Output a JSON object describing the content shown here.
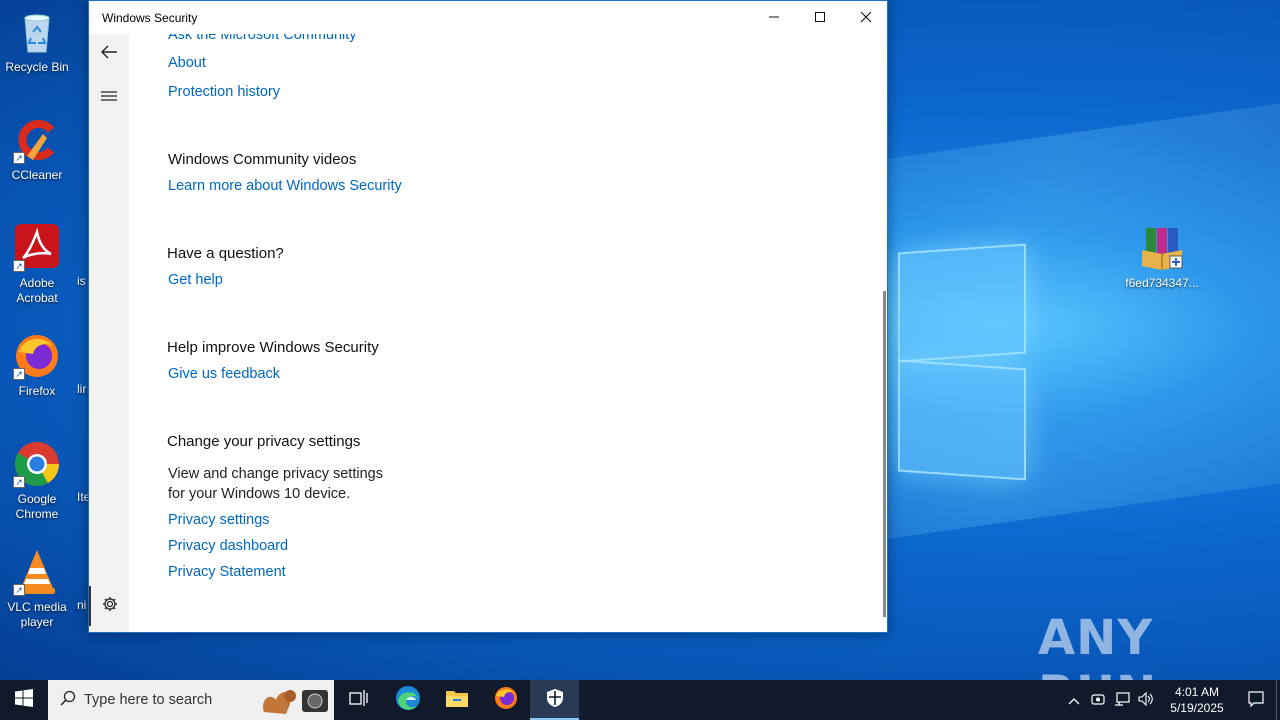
{
  "desktop": {
    "icons": [
      {
        "label": "Recycle Bin",
        "icon": "recycle-bin-icon"
      },
      {
        "label": "CCleaner",
        "icon": "ccleaner-icon"
      },
      {
        "label": "Adobe Acrobat",
        "icon": "adobe-acrobat-icon"
      },
      {
        "label": "Firefox",
        "icon": "firefox-icon"
      },
      {
        "label": "Google Chrome",
        "icon": "chrome-icon"
      },
      {
        "label": "VLC media player",
        "icon": "vlc-icon"
      },
      {
        "label": "f6ed734347...",
        "icon": "winrar-archive-icon"
      }
    ],
    "cut_labels": [
      "is",
      "lir",
      "Ite",
      "ni"
    ],
    "watermark": "ANY RUN"
  },
  "window": {
    "title": "Windows Security",
    "controls": {
      "minimize": "minimize-icon",
      "maximize": "maximize-icon",
      "close": "close-icon"
    },
    "nav": {
      "back": "back-arrow-icon",
      "menu": "hamburger-menu-icon",
      "settings": "gear-icon"
    },
    "content": {
      "ask_community": "Ask the Microsoft Community",
      "about": "About",
      "protection_history": "Protection history",
      "community_videos": {
        "heading": "Windows Community videos",
        "link": "Learn more about Windows Security"
      },
      "question": {
        "heading": "Have a question?",
        "link": "Get help"
      },
      "improve": {
        "heading": "Help improve Windows Security",
        "link": "Give us feedback"
      },
      "privacy": {
        "heading": "Change your privacy settings",
        "description_line1": "View and change privacy settings",
        "description_line2": "for your Windows 10 device.",
        "links": [
          "Privacy settings",
          "Privacy dashboard",
          "Privacy Statement"
        ]
      }
    }
  },
  "taskbar": {
    "search_placeholder": "Type here to search",
    "apps": [
      "task-view-icon",
      "edge-icon",
      "file-explorer-icon",
      "firefox-icon",
      "windows-security-icon"
    ],
    "clock": {
      "time": "4:01 AM",
      "date": "5/19/2025"
    }
  },
  "colors": {
    "link": "#0067c0",
    "taskbar": "#101a2b",
    "desktop": "#0a6fd3"
  }
}
